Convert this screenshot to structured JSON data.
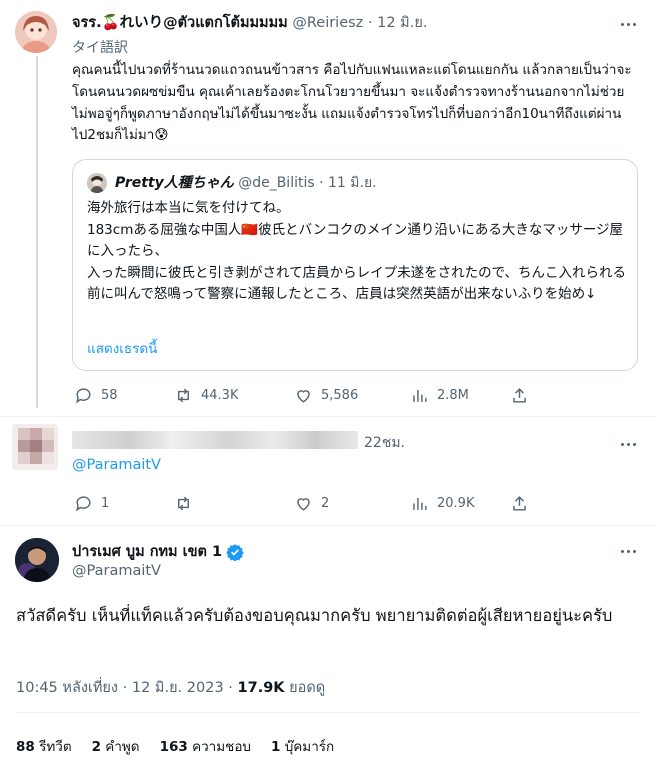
{
  "tweet1": {
    "name": "จรร.🍒れいり@ตัวแตกโต้มมมมม",
    "handle": "@Reiriesz",
    "dot": "·",
    "date": "12 มิ.ย.",
    "translate_label": "タイ語訳",
    "text": "คุณคนนี้ไปนวดที่ร้านนวดแถวถนนข้าวสาร คือไปกับแฟนแหละแต่โดนแยกกัน แล้วกลายเป็นว่าจะโดนคนนวดผซข่มขืน คุณเค้าเลยร้องตะโกนโวยวายขึ้นมา จะแจ้งตำรวจทางร้านนอกจากไม่ช่วยไม่พอจู่ๆก็พูดภาษาอังกฤษไม่ได้ขึ้นมาซะงั้น แถมแจ้งตำรวจโทรไปก็ที่บอกว่าอีก10นาทีถึงแต่ผ่านไป2ชมก็ไม่มา😰",
    "quote": {
      "name": "Pretty人種ちゃん",
      "handle": "@de_Bilitis",
      "dot": "·",
      "date": "11 มิ.ย.",
      "text": "海外旅行は本当に気を付けてね。\n183cmある屈強な中国人🇨🇳彼氏とバンコクのメイン通り沿いにある大きなマッサージ屋に入ったら、\n入った瞬間に彼氏と引き剥がされて店員からレイプ未遂をされたので、ちんこ入れられる前に叫んで怒鳴って警察に通報したところ、店員は突然英語が出来ないふりを始め↓",
      "show_thread": "แสดงเธรดนี้"
    },
    "stats": {
      "replies": "58",
      "retweets": "44.3K",
      "likes": "5,586",
      "views": "2.8M"
    }
  },
  "tweet2": {
    "time": "22ชม.",
    "replying_to": "@ParamaitV",
    "stats": {
      "replies": "1",
      "retweets": "",
      "likes": "2",
      "views": "20.9K"
    }
  },
  "tweet3": {
    "name": "ปารเมศ บูม กทม เขต 1",
    "handle": "@ParamaitV",
    "text": "สวัสดีครับ เห็นที่แท็คแล้วครับต้องขอบคุณมากครับ พยายามติดต่อผู้เสียหายอยู่นะครับ",
    "timestamp": "10:45 หลังเที่ยง · 12 มิ.ย. 2023 · ",
    "views_count": "17.9K",
    "views_label": "ยอดดู",
    "summary": [
      {
        "count": "88",
        "label": "รีทวีต"
      },
      {
        "count": "2",
        "label": "คำพูด"
      },
      {
        "count": "163",
        "label": "ความชอบ"
      },
      {
        "count": "1",
        "label": "บุ๊คมาร์ก"
      }
    ]
  },
  "colors": {
    "link": "#1d9bf0",
    "muted": "#536471",
    "text": "#0f1419",
    "verified": "#1d9bf0"
  }
}
